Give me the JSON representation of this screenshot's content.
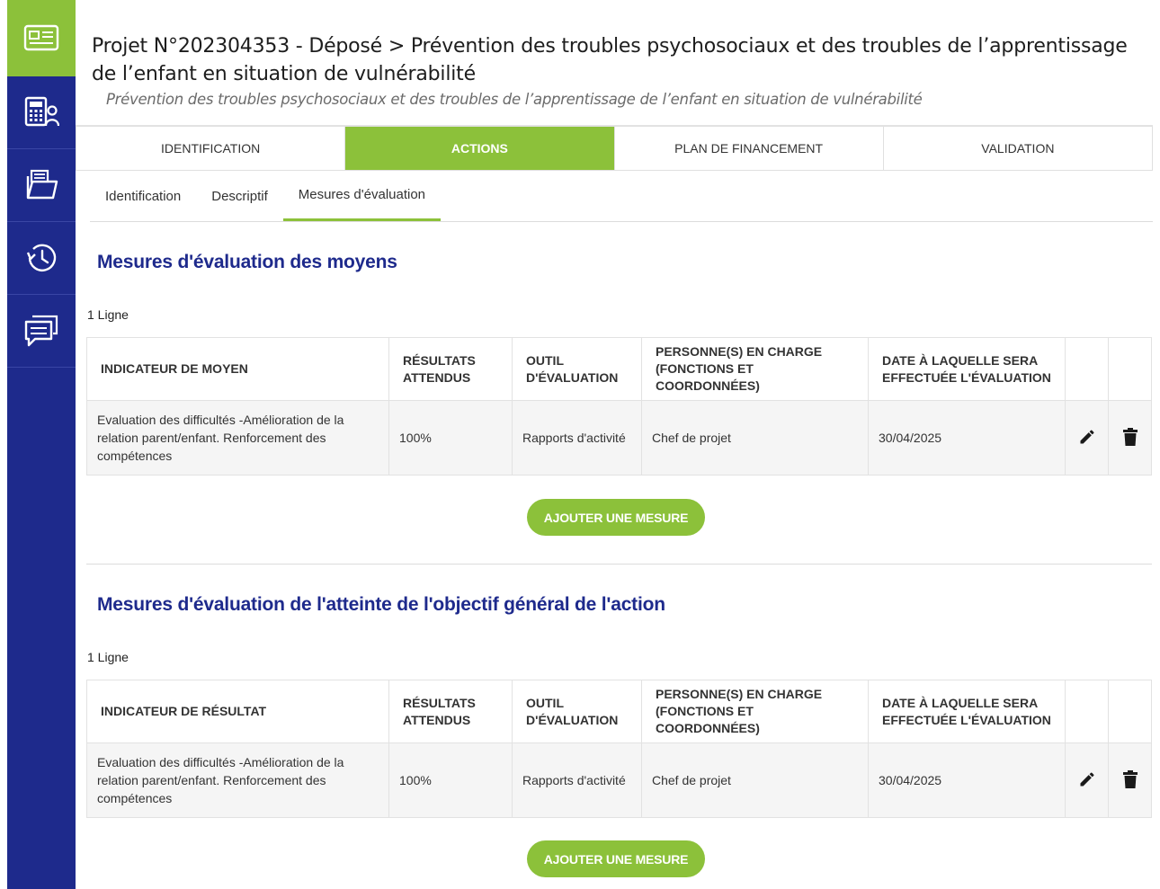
{
  "colors": {
    "sidebar": "#1e2a8c",
    "accent": "#8cc13a",
    "section_title": "#1e2a8c"
  },
  "sidebar": {
    "items": [
      {
        "icon": "id-card-icon"
      },
      {
        "icon": "calculator-person-icon"
      },
      {
        "icon": "folder-document-icon"
      },
      {
        "icon": "history-clock-icon"
      },
      {
        "icon": "chat-bubble-icon"
      }
    ]
  },
  "header": {
    "title": "Projet N°202304353 - Déposé > Prévention des troubles psychosociaux et des troubles de l’apprentissage de l’enfant en situation de vulnérabilité",
    "subtitle": "Prévention des troubles psychosociaux et des troubles de l’apprentissage de l’enfant en situation de vulnérabilité"
  },
  "tabs": [
    {
      "label": "Identification"
    },
    {
      "label": "Actions"
    },
    {
      "label": "Plan de financement"
    },
    {
      "label": "Validation"
    }
  ],
  "subtabs": [
    {
      "label": "Identification"
    },
    {
      "label": "Descriptif"
    },
    {
      "label": "Mesures d'évaluation"
    }
  ],
  "sections": [
    {
      "title": "Mesures d'évaluation des moyens",
      "count": "1 Ligne",
      "columns": [
        "Indicateur de moyen",
        "Résultats attendus",
        "Outil d'évaluation",
        "Personne(s) en charge (fonctions et coordonnées)",
        "Date à laquelle sera effectuée l'évaluation"
      ],
      "rows": [
        {
          "indicator": "Evaluation des difficultés -Amélioration de la relation parent/enfant. Renforcement des compétences",
          "expected": "100%",
          "tool": "Rapports d'activité",
          "person": "Chef de projet",
          "date": "30/04/2025"
        }
      ],
      "add_label": "Ajouter une mesure"
    },
    {
      "title": "Mesures d'évaluation de l'atteinte de l'objectif général de l'action",
      "count": "1 Ligne",
      "columns": [
        "Indicateur de résultat",
        "Résultats attendus",
        "Outil d'évaluation",
        "Personne(s) en charge (fonctions et coordonnées)",
        "Date à laquelle sera effectuée l'évaluation"
      ],
      "rows": [
        {
          "indicator": "Evaluation des difficultés -Amélioration de la relation parent/enfant. Renforcement des compétences",
          "expected": "100%",
          "tool": "Rapports d'activité",
          "person": "Chef de projet",
          "date": "30/04/2025"
        }
      ],
      "add_label": "Ajouter une mesure"
    }
  ]
}
